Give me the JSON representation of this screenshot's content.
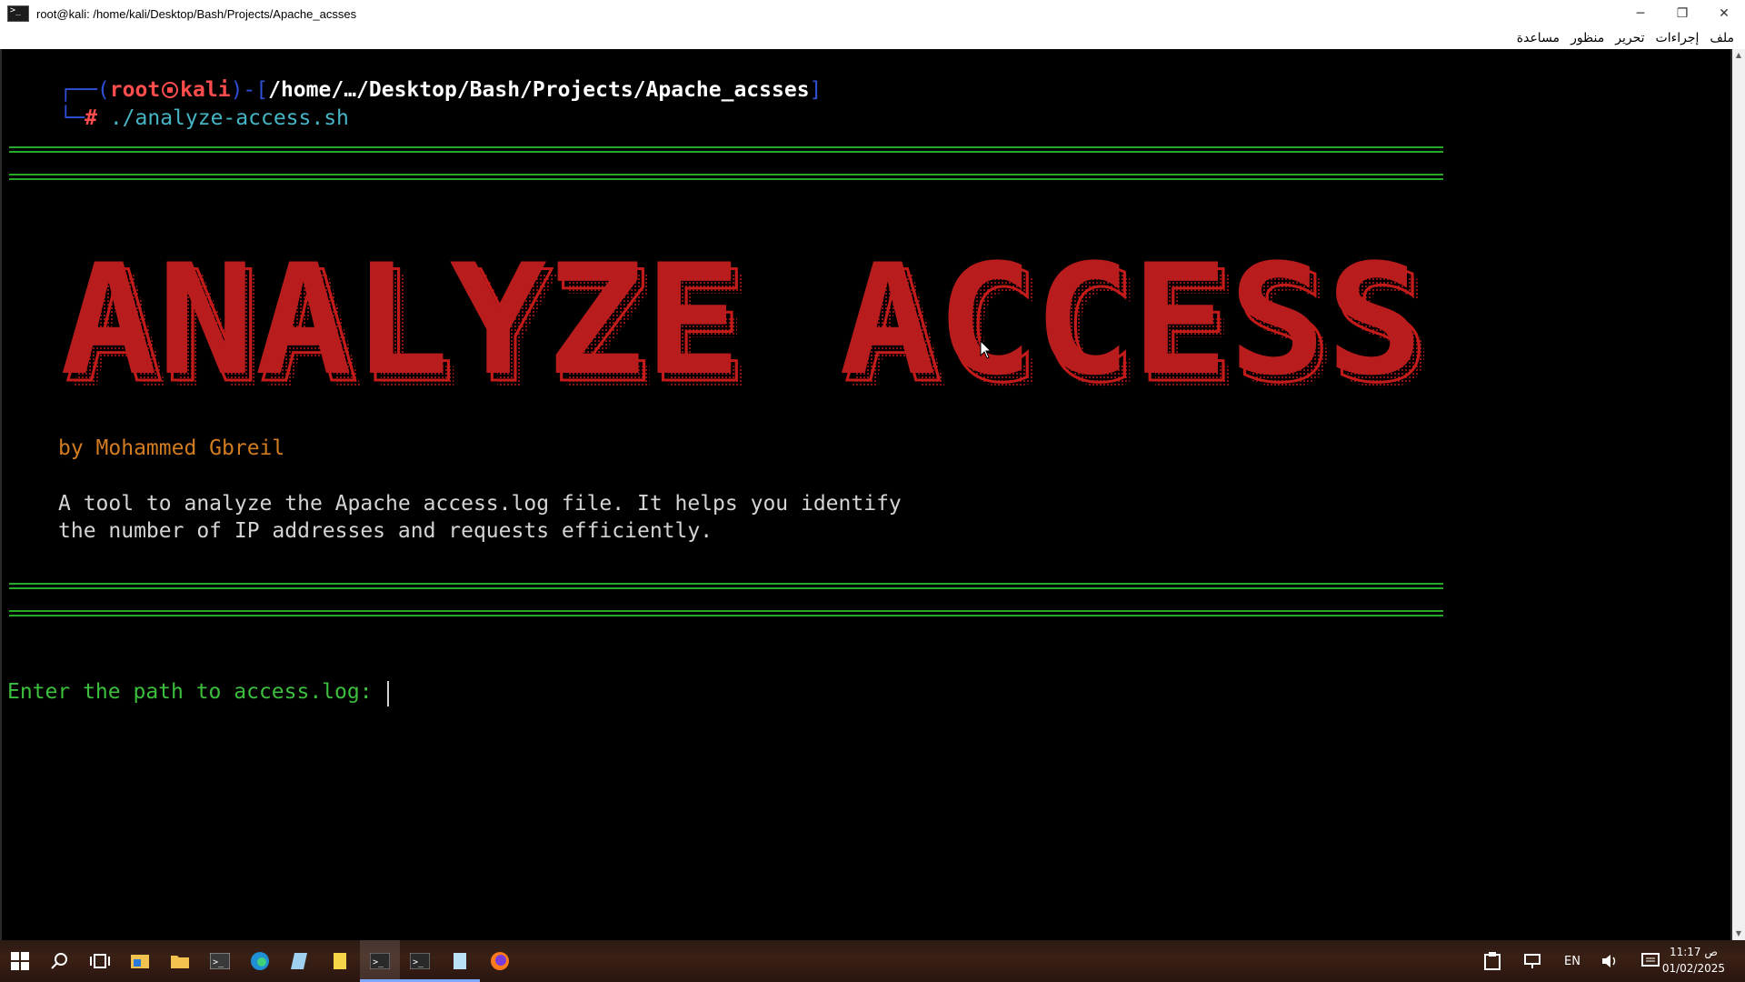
{
  "window": {
    "title": "root@kali: /home/kali/Desktop/Bash/Projects/Apache_acsses",
    "controls": {
      "minimize": "─",
      "restore": "❐",
      "close": "✕"
    }
  },
  "menubar": {
    "items": [
      "ملف",
      "إجراءات",
      "تحرير",
      "منظور",
      "مساعدة"
    ]
  },
  "terminal": {
    "prompt": {
      "open_bracket": "┌──(",
      "user": "root",
      "host": "kali",
      "mid": ")-[",
      "path": "/home/…/Desktop/Bash/Projects/Apache_acsses",
      "close": "]",
      "line2_prefix": "└─",
      "hash": "#",
      "command": "./analyze-access.sh"
    },
    "banner": {
      "text": "ANALYZE ACCESS",
      "color": "#c31a1a"
    },
    "author": "by Mohammed Gbreil",
    "description_line1": "A tool to analyze the Apache access.log file. It helps you identify",
    "description_line2": "the number of IP addresses and requests efficiently.",
    "input_prompt": "Enter the path to access.log: "
  },
  "taskbar": {
    "icons": [
      "windows-start-icon",
      "search-icon",
      "task-view-icon",
      "file-explorer-icon",
      "folder-icon",
      "terminal-icon",
      "edge-icon",
      "notepad-icon",
      "sticky-notes-icon",
      "kali-terminal-icon",
      "terminal-icon",
      "notepad-icon",
      "firefox-icon"
    ],
    "language": "EN",
    "time": "11:17 ص",
    "date": "01/02/2025"
  },
  "colors": {
    "prompt_blue": "#2f4fd6",
    "prompt_red": "#ff4d4d",
    "command_cyan": "#45b5c6",
    "author_orange": "#d27c22",
    "rule_green": "#28a828",
    "input_green": "#3cbf3c"
  }
}
